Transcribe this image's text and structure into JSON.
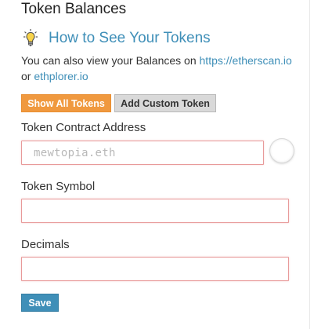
{
  "panel": {
    "title": "Token Balances"
  },
  "howto": {
    "icon": "lightbulb-icon",
    "title": "How to See Your Tokens"
  },
  "info": {
    "text_before": "You can also view your Balances on ",
    "link1": "https://etherscan.io",
    "text_middle": "or ",
    "link2": "ethplorer.io"
  },
  "buttons": {
    "show_all": "Show All Tokens",
    "add_custom": "Add Custom Token",
    "save": "Save"
  },
  "form": {
    "contract_label": "Token Contract Address",
    "contract_placeholder": "mewtopia.eth",
    "contract_value": "",
    "symbol_label": "Token Symbol",
    "symbol_value": "",
    "decimals_label": "Decimals",
    "decimals_value": ""
  },
  "colors": {
    "accent_blue": "#3f8fb8",
    "orange": "#f0993f",
    "gray_button": "#d9d9d9",
    "input_border_error": "#e89a9a"
  }
}
